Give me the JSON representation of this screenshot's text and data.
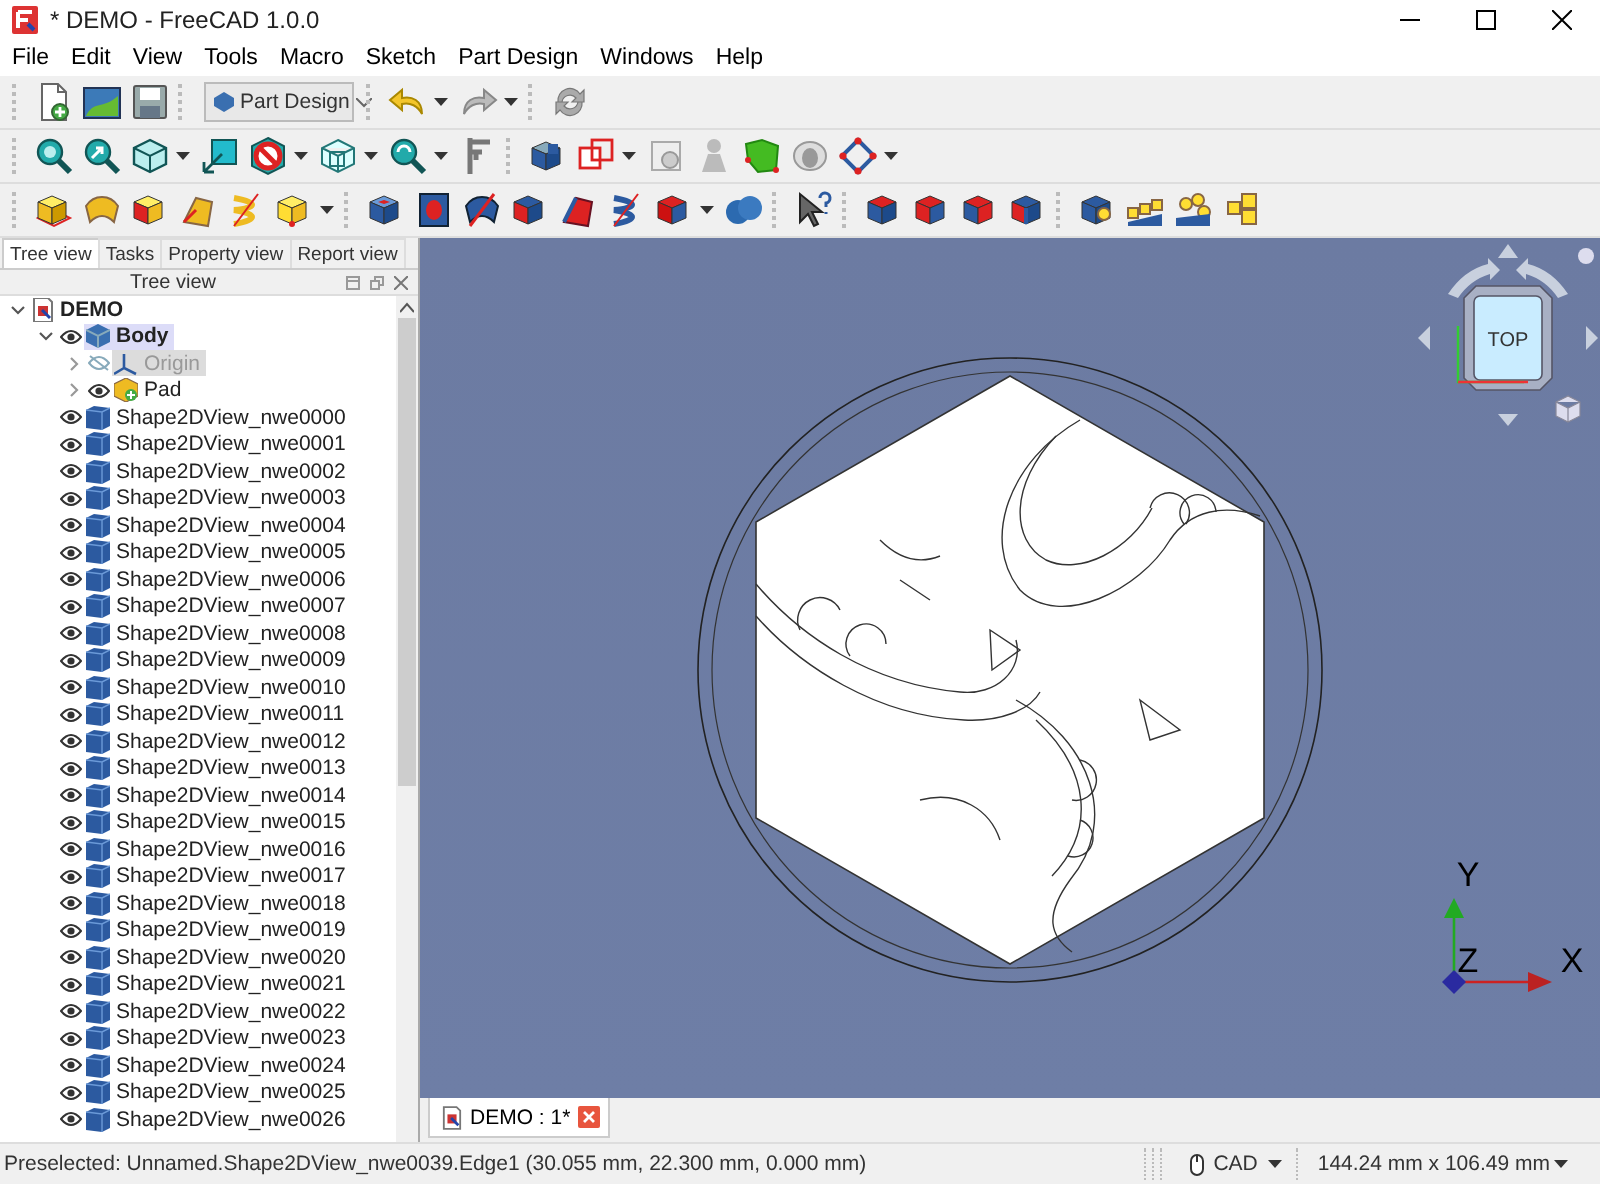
{
  "window": {
    "title": "* DEMO - FreeCAD 1.0.0"
  },
  "menu": [
    {
      "label": "File"
    },
    {
      "label": "Edit"
    },
    {
      "label": "View"
    },
    {
      "label": "Tools"
    },
    {
      "label": "Macro"
    },
    {
      "label": "Sketch"
    },
    {
      "label": "Part Design"
    },
    {
      "label": "Windows"
    },
    {
      "label": "Help"
    }
  ],
  "workbench": {
    "value": "Part Design"
  },
  "panel": {
    "tabs": [
      {
        "label": "Tree view",
        "selected": true
      },
      {
        "label": "Tasks",
        "selected": false
      },
      {
        "label": "Property view",
        "selected": false
      },
      {
        "label": "Report view",
        "selected": false
      }
    ],
    "header": "Tree view",
    "tree": [
      {
        "label": "DEMO",
        "kind": "document",
        "expanded": true,
        "children": [
          {
            "label": "Body",
            "kind": "body",
            "expanded": true,
            "active": true,
            "visible": true,
            "children": [
              {
                "label": "Origin",
                "kind": "origin",
                "expanded": false,
                "visible": false
              },
              {
                "label": "Pad",
                "kind": "pad",
                "expanded": false,
                "visible": true
              }
            ]
          },
          {
            "label": "Shape2DView_nwe0000",
            "kind": "shape",
            "visible": true
          },
          {
            "label": "Shape2DView_nwe0001",
            "kind": "shape",
            "visible": true
          },
          {
            "label": "Shape2DView_nwe0002",
            "kind": "shape",
            "visible": true
          },
          {
            "label": "Shape2DView_nwe0003",
            "kind": "shape",
            "visible": true
          },
          {
            "label": "Shape2DView_nwe0004",
            "kind": "shape",
            "visible": true
          },
          {
            "label": "Shape2DView_nwe0005",
            "kind": "shape",
            "visible": true
          },
          {
            "label": "Shape2DView_nwe0006",
            "kind": "shape",
            "visible": true
          },
          {
            "label": "Shape2DView_nwe0007",
            "kind": "shape",
            "visible": true
          },
          {
            "label": "Shape2DView_nwe0008",
            "kind": "shape",
            "visible": true
          },
          {
            "label": "Shape2DView_nwe0009",
            "kind": "shape",
            "visible": true
          },
          {
            "label": "Shape2DView_nwe0010",
            "kind": "shape",
            "visible": true
          },
          {
            "label": "Shape2DView_nwe0011",
            "kind": "shape",
            "visible": true
          },
          {
            "label": "Shape2DView_nwe0012",
            "kind": "shape",
            "visible": true
          },
          {
            "label": "Shape2DView_nwe0013",
            "kind": "shape",
            "visible": true
          },
          {
            "label": "Shape2DView_nwe0014",
            "kind": "shape",
            "visible": true
          },
          {
            "label": "Shape2DView_nwe0015",
            "kind": "shape",
            "visible": true
          },
          {
            "label": "Shape2DView_nwe0016",
            "kind": "shape",
            "visible": true
          },
          {
            "label": "Shape2DView_nwe0017",
            "kind": "shape",
            "visible": true
          },
          {
            "label": "Shape2DView_nwe0018",
            "kind": "shape",
            "visible": true
          },
          {
            "label": "Shape2DView_nwe0019",
            "kind": "shape",
            "visible": true
          },
          {
            "label": "Shape2DView_nwe0020",
            "kind": "shape",
            "visible": true
          },
          {
            "label": "Shape2DView_nwe0021",
            "kind": "shape",
            "visible": true
          },
          {
            "label": "Shape2DView_nwe0022",
            "kind": "shape",
            "visible": true
          },
          {
            "label": "Shape2DView_nwe0023",
            "kind": "shape",
            "visible": true
          },
          {
            "label": "Shape2DView_nwe0024",
            "kind": "shape",
            "visible": true
          },
          {
            "label": "Shape2DView_nwe0025",
            "kind": "shape",
            "visible": true
          },
          {
            "label": "Shape2DView_nwe0026",
            "kind": "shape",
            "visible": true
          }
        ]
      }
    ]
  },
  "viewport": {
    "nav_cube": {
      "face": "TOP"
    },
    "axes": {
      "x": "X",
      "y": "Y",
      "z": "Z"
    },
    "document_tab": {
      "label": "DEMO : 1*",
      "selected": true
    }
  },
  "status_bar": {
    "message": "Preselected: Unnamed.Shape2DView_nwe0039.Edge1 (30.055 mm, 22.300 mm, 0.000 mm)",
    "navigation": "CAD",
    "dimensions": "144.24 mm x 106.49 mm"
  }
}
